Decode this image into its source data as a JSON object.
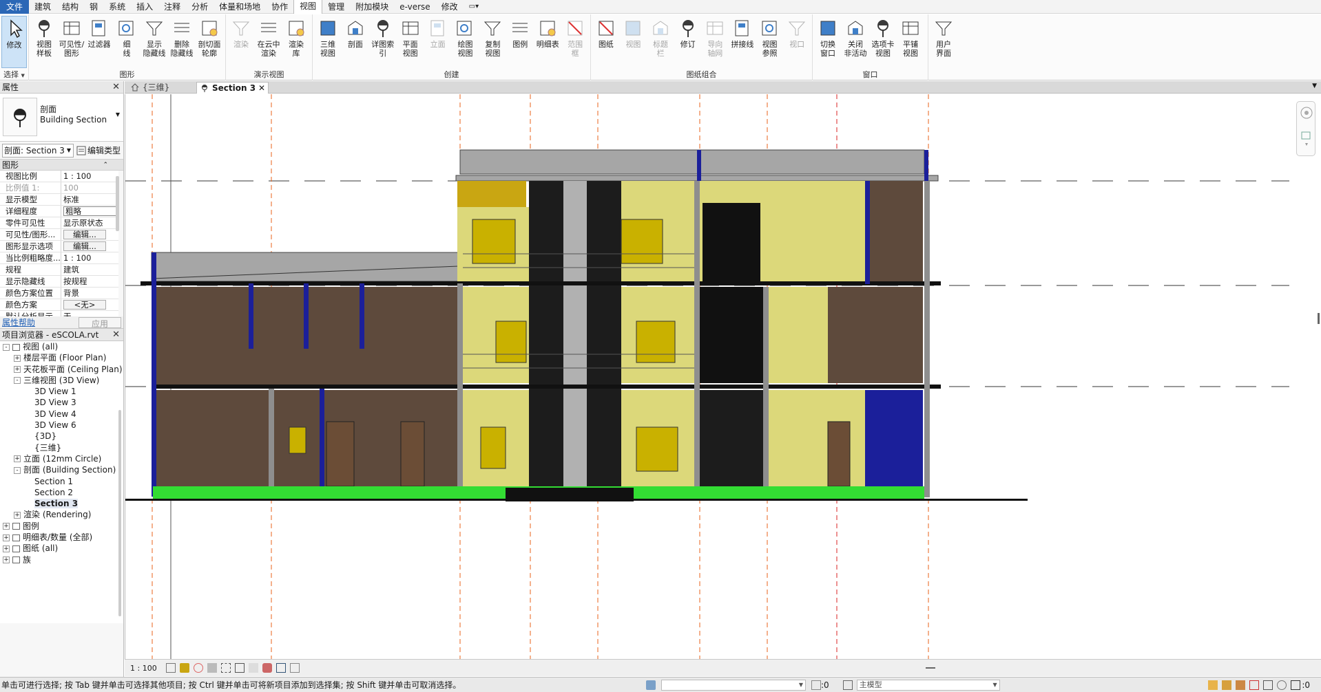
{
  "menu": {
    "tabs": [
      "文件",
      "建筑",
      "结构",
      "钢",
      "系统",
      "插入",
      "注释",
      "分析",
      "体量和场地",
      "协作",
      "视图",
      "管理",
      "附加模块",
      "e-verse",
      "修改"
    ],
    "active": "视图"
  },
  "ribbon": {
    "select": {
      "button": "修改",
      "label": "选择"
    },
    "graphics": {
      "label": "图形",
      "buttons": [
        "视图\n样板",
        "可见性/\n图形",
        "过滤器",
        "细\n线",
        "显示\n隐藏线",
        "删除\n隐藏线",
        "剖切面\n轮廓"
      ]
    },
    "presentation": {
      "label": "演示视图",
      "buttons": [
        "渲染",
        "在云中\n渲染",
        "渲染\n库"
      ]
    },
    "create": {
      "label": "创建",
      "buttons": [
        "三维\n视图",
        "剖面",
        "详图索引",
        "平面\n视图",
        "立面",
        "绘图\n视图",
        "复制\n视图",
        "图例",
        "明细表",
        "范围\n框"
      ]
    },
    "sheet": {
      "label": "图纸组合",
      "buttons": [
        "图纸",
        "视图",
        "标题\n栏",
        "修订",
        "导向\n轴网",
        "拼接线",
        "视图\n参照",
        "视口"
      ]
    },
    "window": {
      "label": "窗口",
      "buttons": [
        "切换\n窗口",
        "关闭\n非活动",
        "选项卡\n视图",
        "平铺\n视图"
      ]
    },
    "ui": {
      "buttons": [
        "用户\n界面"
      ]
    }
  },
  "properties": {
    "title": "属性",
    "type_line1": "剖面",
    "type_line2": "Building Section",
    "filter": "剖面: Section 3",
    "edit_type": "编辑类型",
    "category": "图形",
    "rows": [
      {
        "name": "视图比例",
        "value": "1 : 100"
      },
      {
        "name": "比例值 1:",
        "value": "100"
      },
      {
        "name": "显示模型",
        "value": "标准"
      },
      {
        "name": "详细程度",
        "value": "粗略"
      },
      {
        "name": "零件可见性",
        "value": "显示原状态"
      },
      {
        "name": "可见性/图形...",
        "value": "编辑..."
      },
      {
        "name": "图形显示选项",
        "value": "编辑..."
      },
      {
        "name": "当比例粗略度...",
        "value": "1 : 100"
      },
      {
        "name": "规程",
        "value": "建筑"
      },
      {
        "name": "显示隐藏线",
        "value": "按规程"
      },
      {
        "name": "颜色方案位置",
        "value": "背景"
      },
      {
        "name": "颜色方案",
        "value": "<无>"
      },
      {
        "name": "默认分析显示...",
        "value": "无"
      }
    ],
    "help_link": "属性帮助",
    "apply": "应用"
  },
  "browser": {
    "title": "项目浏览器 - eSCOLA.rvt",
    "items": [
      {
        "text": "视图 (all)",
        "level": 0,
        "toggle": "-"
      },
      {
        "text": "楼层平面 (Floor Plan)",
        "level": 1,
        "toggle": "+"
      },
      {
        "text": "天花板平面 (Ceiling Plan)",
        "level": 1,
        "toggle": "+"
      },
      {
        "text": "三维视图 (3D View)",
        "level": 1,
        "toggle": "-"
      },
      {
        "text": "3D View 1",
        "level": 2,
        "toggle": ""
      },
      {
        "text": "3D View 3",
        "level": 2,
        "toggle": ""
      },
      {
        "text": "3D View 4",
        "level": 2,
        "toggle": ""
      },
      {
        "text": "3D View 6",
        "level": 2,
        "toggle": ""
      },
      {
        "text": "{3D}",
        "level": 2,
        "toggle": ""
      },
      {
        "text": "{三维}",
        "level": 2,
        "toggle": ""
      },
      {
        "text": "立面 (12mm Circle)",
        "level": 1,
        "toggle": "+"
      },
      {
        "text": "剖面 (Building Section)",
        "level": 1,
        "toggle": "-"
      },
      {
        "text": "Section 1",
        "level": 2,
        "toggle": ""
      },
      {
        "text": "Section 2",
        "level": 2,
        "toggle": ""
      },
      {
        "text": "Section 3",
        "level": 2,
        "toggle": "",
        "selected": true
      },
      {
        "text": "渲染 (Rendering)",
        "level": 1,
        "toggle": "+"
      },
      {
        "text": "图例",
        "level": 0,
        "toggle": "+"
      },
      {
        "text": "明细表/数量 (全部)",
        "level": 0,
        "toggle": "+"
      },
      {
        "text": "图纸 (all)",
        "level": 0,
        "toggle": "+"
      },
      {
        "text": "族",
        "level": 0,
        "toggle": "+"
      }
    ]
  },
  "doc_tabs": [
    {
      "label": "{三维}",
      "active": false
    },
    {
      "label": "Section 3",
      "active": true
    }
  ],
  "view_bar": {
    "scale": "1 : 100"
  },
  "status": {
    "message": "单击可进行选择; 按 Tab 键并单击可选择其他项目; 按 Ctrl 键并单击可将新项目添加到选择集; 按 Shift 键并单击可取消选择。",
    "sel_count": ":0",
    "model": "主模型",
    "filter_count": ":0"
  },
  "colors": {
    "file_tab": "#2b67b6",
    "brick": "#5e4a3c",
    "yellow_wall": "#dcd87a",
    "ground": "#33dd33",
    "roof": "#a6a6a6",
    "blue_column": "#1b1f9a"
  }
}
